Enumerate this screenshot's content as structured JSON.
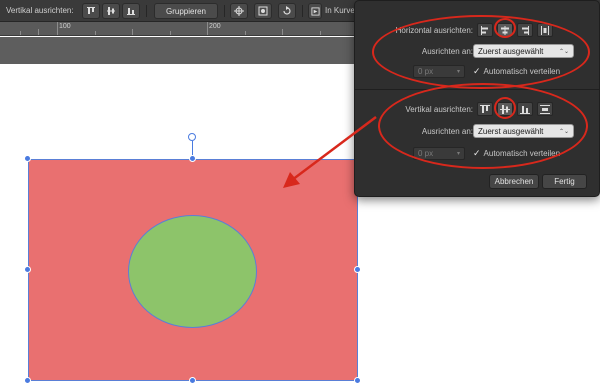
{
  "toolbar": {
    "vertical_align_label": "Vertikal ausrichten:",
    "group_button": "Gruppieren",
    "convert_button": "In Kurve"
  },
  "ruler": {
    "marks": [
      "100",
      "200"
    ]
  },
  "panel": {
    "horizontal_label": "Horizontal ausrichten:",
    "horizontal_target_label": "Ausrichten an:",
    "horizontal_target_value": "Zuerst ausgewählt",
    "horizontal_spacing": "0 px",
    "horizontal_auto_distribute": "Automatisch verteilen",
    "vertical_label": "Vertikal ausrichten:",
    "vertical_target_label": "Ausrichten an:",
    "vertical_target_value": "Zuerst ausgewählt",
    "vertical_spacing": "0 px",
    "vertical_auto_distribute": "Automatisch verteilen",
    "cancel_button": "Abbrechen",
    "ok_button": "Fertig"
  },
  "colors": {
    "annotation": "#d8281c",
    "rectangle_fill": "#e97070",
    "circle_fill": "#8dc46a",
    "selection": "#4a7be0",
    "panel_bg": "#2f2f2f",
    "toolbar_bg": "#3a3a3a"
  },
  "icons": {
    "checkbox": "✓",
    "select_chevron": "⌃⌄",
    "number_chevron": "▾"
  }
}
